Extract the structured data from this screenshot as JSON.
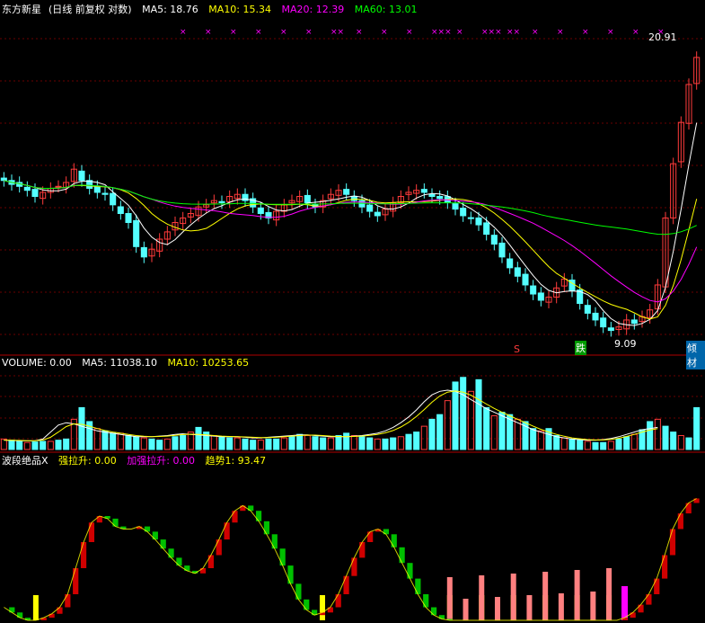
{
  "colors": {
    "background": "#000000",
    "up": "#ff3b3b",
    "down": "#54ffff",
    "ma5": "#ffffff",
    "ma10": "#ffff00",
    "ma20": "#ff00ff",
    "ma60": "#00ff00",
    "panel_border": "#b00000",
    "label_white": "#ffffff",
    "label_yellow": "#ffff00",
    "label_magenta": "#ff00ff",
    "osc_red": "#d00000",
    "osc_green": "#00c000",
    "bar_yellow": "#ffff00",
    "bar_pink": "#ff8080",
    "bar_magenta": "#ff00ff"
  },
  "price_panel": {
    "stock_name": "东方新星",
    "mode": "(日线 前复权 对数)",
    "ma5_label": "MA5: 18.76",
    "ma10_label": "MA10: 15.34",
    "ma20_label": "MA20: 12.39",
    "ma60_label": "MA60: 13.01",
    "high_label": "20.91",
    "low_label": "9.09",
    "signal_s": "S",
    "signal_die": "跌",
    "signal_guan": "倾材",
    "x_markers": [
      "×",
      "×",
      "×",
      "×",
      "×",
      "×",
      "××",
      "×",
      "×",
      "×",
      "×××",
      "×",
      "×××",
      "××",
      "×",
      "×",
      "×",
      "×",
      "×",
      "×"
    ]
  },
  "volume_panel": {
    "vol_label": "VOLUME: 0.00",
    "ma5_label": "MA5: 11038.10",
    "ma10_label": "MA10: 10253.65"
  },
  "indicator_panel": {
    "name": "波段绝品X",
    "strong_label": "强拉升: 0.00",
    "boost_label": "加强拉升: 0.00",
    "trend_label": "趋势1: 93.47"
  },
  "chart_data": [
    {
      "type": "candlestick",
      "title": "东方新星 日线 前复权 对数",
      "note": "price trajectory with moving averages MA5/MA10/MA20/MA60",
      "close_path": [
        12.6,
        12.4,
        12.3,
        12.1,
        11.8,
        12.0,
        12.2,
        12.3,
        12.5,
        13.2,
        12.6,
        12.2,
        12.0,
        11.9,
        11.4,
        11.0,
        10.6,
        9.6,
        9.2,
        9.5,
        9.9,
        10.2,
        10.6,
        10.8,
        11.0,
        11.3,
        11.4,
        11.6,
        11.5,
        11.8,
        11.9,
        11.6,
        11.3,
        11.0,
        10.8,
        11.1,
        11.4,
        11.6,
        11.8,
        11.5,
        11.3,
        11.6,
        11.9,
        12.1,
        11.9,
        11.6,
        11.3,
        11.1,
        10.9,
        11.2,
        11.5,
        11.8,
        12.0,
        12.1,
        12.0,
        11.8,
        11.7,
        11.5,
        11.2,
        10.9,
        10.8,
        10.5,
        10.1,
        9.7,
        9.2,
        8.8,
        8.5,
        8.2,
        7.9,
        7.7,
        7.8,
        8.1,
        8.4,
        8.0,
        7.6,
        7.3,
        7.1,
        6.9,
        6.8,
        6.9,
        7.1,
        7.0,
        7.2,
        7.4,
        8.2,
        10.8,
        13.5,
        16.0,
        18.7,
        20.9
      ],
      "annotations": {
        "high": 20.91,
        "low": 9.09
      }
    },
    {
      "type": "bar",
      "title": "VOLUME",
      "volume_path": [
        900,
        800,
        700,
        600,
        650,
        700,
        700,
        800,
        900,
        2600,
        3600,
        2400,
        1800,
        1600,
        1400,
        1400,
        1200,
        1100,
        1000,
        900,
        800,
        900,
        1100,
        1200,
        1500,
        1900,
        1500,
        1200,
        1100,
        1000,
        1000,
        900,
        800,
        800,
        900,
        900,
        1000,
        1100,
        1300,
        1200,
        1100,
        1000,
        1000,
        1200,
        1400,
        1200,
        1100,
        1000,
        900,
        900,
        1000,
        1100,
        1300,
        1500,
        2000,
        2600,
        3000,
        4200,
        5800,
        6200,
        5000,
        6000,
        3600,
        2900,
        3200,
        3000,
        2600,
        2400,
        1800,
        1600,
        1800,
        1200,
        1000,
        900,
        800,
        700,
        600,
        600,
        700,
        900,
        1100,
        1300,
        1700,
        2400,
        2600,
        2000,
        1500,
        1200,
        1000,
        3600
      ],
      "ma5_path": [
        800,
        780,
        760,
        740,
        760,
        900,
        1500,
        2100,
        2300,
        2200,
        2000,
        1800,
        1600,
        1500,
        1400,
        1300,
        1200,
        1100,
        1100,
        1100,
        1150,
        1200,
        1300,
        1350,
        1300,
        1250,
        1200,
        1150,
        1100,
        1100,
        1100,
        1050,
        1000,
        1000,
        1050,
        1100,
        1150,
        1200,
        1250,
        1250,
        1200,
        1150,
        1100,
        1100,
        1100,
        1150,
        1200,
        1300,
        1400,
        1600,
        1900,
        2300,
        2800,
        3400,
        4100,
        4700,
        5000,
        5100,
        5000,
        4700,
        4300,
        3900,
        3500,
        3200,
        2900,
        2600,
        2300,
        2000,
        1700,
        1500,
        1300,
        1100,
        1000,
        900,
        850,
        800,
        800,
        850,
        950,
        1100,
        1300,
        1500,
        1700,
        1800,
        1900
      ]
    },
    {
      "type": "bar",
      "title": "波段绝品X",
      "trend_path": [
        10,
        6,
        2,
        0,
        0,
        2,
        5,
        10,
        20,
        40,
        60,
        75,
        80,
        78,
        72,
        70,
        70,
        72,
        68,
        62,
        55,
        48,
        42,
        38,
        36,
        40,
        50,
        62,
        75,
        84,
        88,
        84,
        76,
        66,
        55,
        42,
        28,
        16,
        8,
        4,
        6,
        10,
        20,
        34,
        48,
        60,
        68,
        70,
        66,
        56,
        44,
        32,
        20,
        10,
        4,
        1,
        0,
        0,
        0,
        0,
        0,
        0,
        0,
        0,
        0,
        0,
        0,
        0,
        0,
        0,
        0,
        0,
        0,
        0,
        0,
        0,
        0,
        0,
        2,
        6,
        12,
        20,
        32,
        50,
        70,
        82,
        90,
        93.47
      ]
    }
  ]
}
